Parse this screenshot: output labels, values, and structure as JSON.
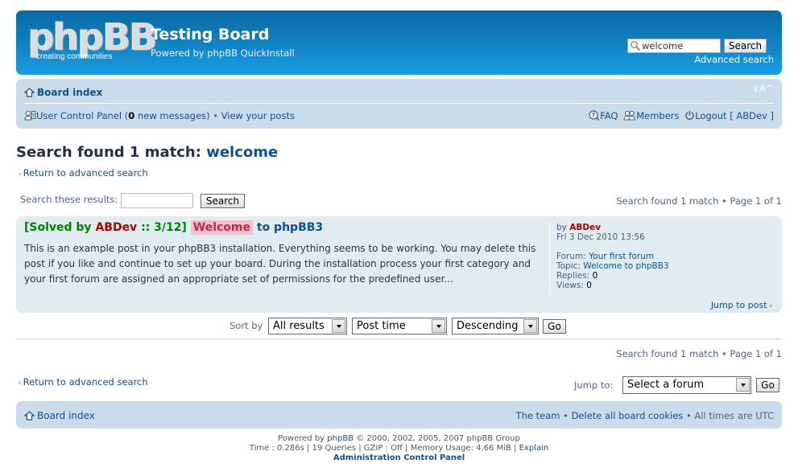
{
  "header": {
    "logo_main": "phpBB",
    "logo_tagline": "creating  communities",
    "site_title": "Testing Board",
    "site_description": "Powered by phpBB QuickInstall",
    "search": {
      "value": "welcome",
      "button_label": "Search",
      "advanced_link": "Advanced search"
    }
  },
  "navbar": {
    "breadcrumb": "Board index",
    "font_size_control": "∨A^",
    "user_links": {
      "ucp_label": "User Control Panel",
      "new_messages_count": "0",
      "new_messages_suffix": "new messages",
      "view_posts": "View your posts"
    },
    "right_links": {
      "faq": "FAQ",
      "members": "Members",
      "logout": "Logout [ ABDev ]"
    }
  },
  "main": {
    "title_prefix": "Search found 1 match:",
    "title_keyword": "welcome",
    "return_link": "Return to advanced search",
    "search_results_label": "Search these results:",
    "search_results_value": "",
    "search_results_button": "Search",
    "pagination": "Search found 1 match • Page 1 of 1",
    "results": [
      {
        "prefix": "[Solved by",
        "solver": "ABDev",
        "suffix": ":: 3/12]",
        "highlight": "Welcome",
        "title_rest": "to phpBB3",
        "excerpt": "This is an example post in your phpBB3 installation. Everything seems to be working. You may delete this post if you like and continue to set up your board. During the installation process your first category and your first forum are assigned an appropriate set of permissions for the predefined user...",
        "by_label": "by",
        "author": "ABDev",
        "date": "Fri 3 Dec 2010 13:56",
        "forum_label": "Forum:",
        "forum": "Your first forum",
        "topic_label": "Topic:",
        "topic": "Welcome to phpBB3",
        "replies_label": "Replies:",
        "replies": "0",
        "views_label": "Views:",
        "views": "0",
        "jump_label": "Jump to post"
      }
    ],
    "sort": {
      "label": "Sort by",
      "display": "All results",
      "key": "Post time",
      "direction": "Descending",
      "go_label": "Go"
    },
    "jumpbox": {
      "label": "Jump to:",
      "selected": "Select a forum",
      "go_label": "Go"
    }
  },
  "footer": {
    "breadcrumb": "Board index",
    "team_link": "The team",
    "delete_cookies": "Delete all board cookies",
    "timezone": "All times are UTC",
    "powered_prefix": "Powered by",
    "powered_link": "phpBB",
    "powered_suffix": "© 2000, 2002, 2005, 2007 phpBB Group",
    "debug": "Time : 0.286s | 19 Queries | GZIP : Off | Memory Usage: 4.66 MiB |",
    "explain_link": "Explain",
    "acp_link": "Administration Control Panel"
  },
  "colors": {
    "header_blue": "#1283c4",
    "navbar_bg": "#cadceb",
    "result_bg": "#e1ebf2",
    "link": "#105289",
    "author": "#aa0000",
    "solved": "#008000",
    "highlight_bg": "#f3bfcc"
  }
}
